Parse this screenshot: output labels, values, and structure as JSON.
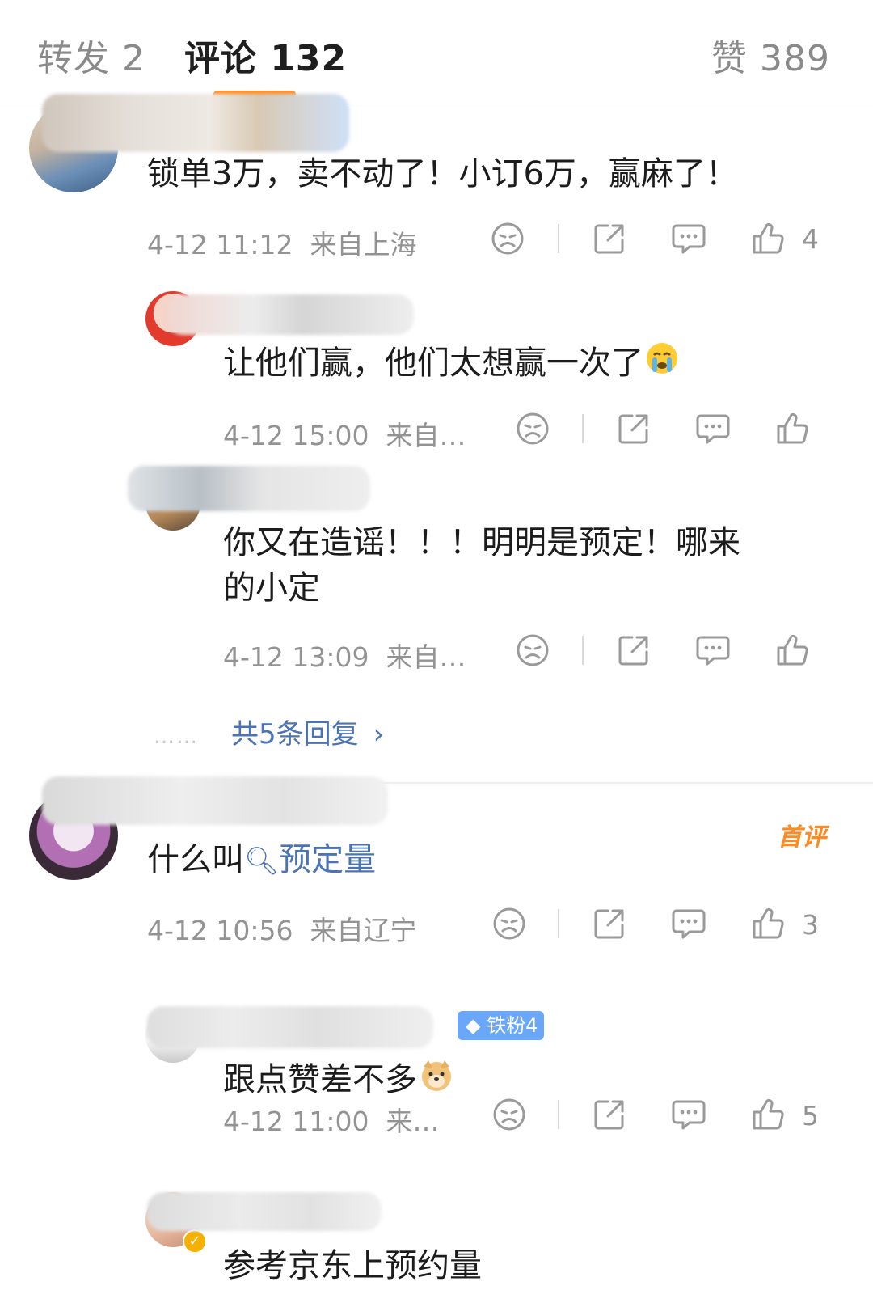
{
  "tabs": {
    "repost": "转发 2",
    "comments": "评论 132",
    "likes": "赞 389"
  },
  "comments": [
    {
      "text": "锁单3万，卖不动了！小订6万，赢麻了！",
      "time": "4-12 11:12",
      "location": "来自上海",
      "likes": "4"
    },
    {
      "text": "什么叫",
      "topic": "预定量",
      "time": "4-12 10:56",
      "location": "来自辽宁",
      "likes": "3",
      "first_comment_label": "首评"
    }
  ],
  "replies": [
    {
      "text": "让他们赢，他们太想赢一次了",
      "time": "4-12 15:00",
      "location": "来自…"
    },
    {
      "text_line1": "你又在造谣！！！明明是预定！哪来",
      "text_line2": "的小定",
      "time": "4-12 13:09",
      "location": "来自…"
    },
    {
      "text": "跟点赞差不多",
      "time": "4-12 11:00",
      "location": "来…",
      "likes": "5",
      "badge": "铁粉4"
    },
    {
      "text": "参考京东上预约量"
    }
  ],
  "more_replies": "共5条回复",
  "colors": {
    "accent": "#ff8a1f",
    "link": "#4a73b8",
    "badge": "#6aa7f8",
    "meta": "#939393"
  }
}
